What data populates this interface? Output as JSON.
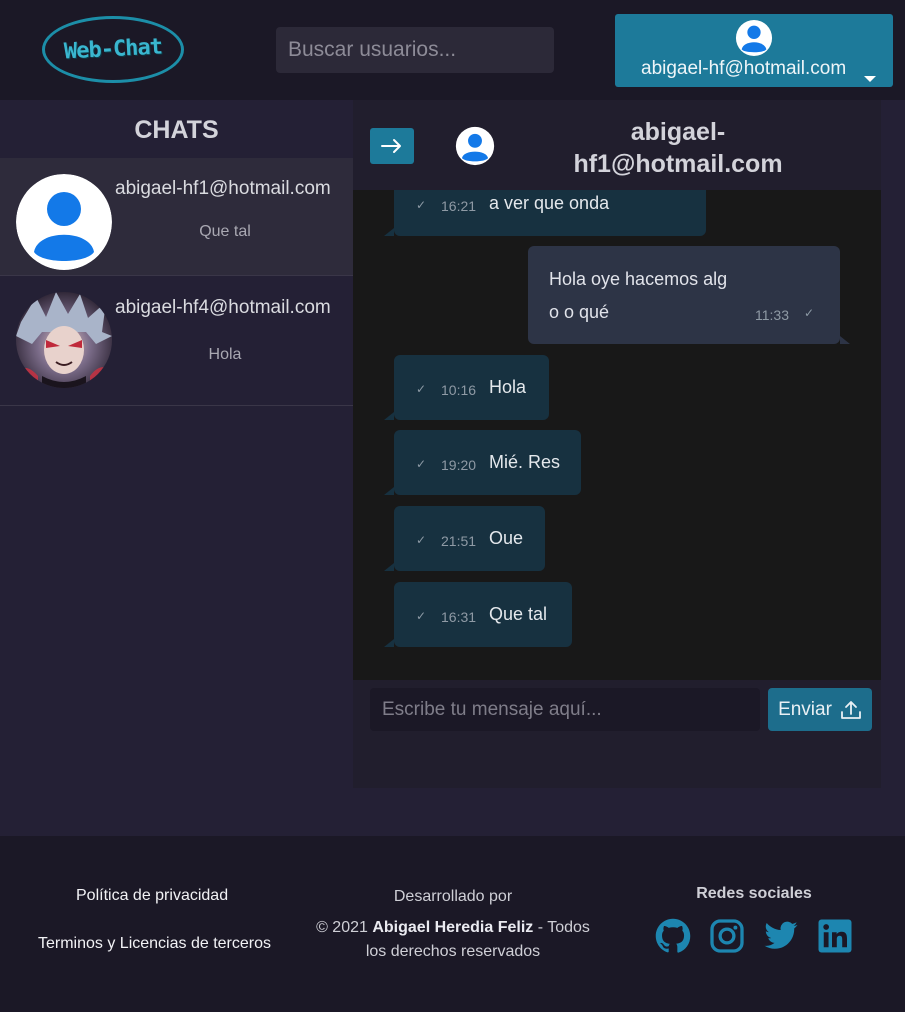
{
  "header": {
    "logo_text": "Web-Chat",
    "search_placeholder": "Buscar usuarios...",
    "account_email": "abigael-hf@hotmail.com"
  },
  "sidebar": {
    "title": "CHATS",
    "chats": [
      {
        "name": "abigael-hf1@hotmail.com",
        "last_message": "Que tal",
        "avatar": "default-user-icon",
        "active": true
      },
      {
        "name": "abigael-hf4@hotmail.com",
        "last_message": "Hola",
        "avatar": "anime-character-photo",
        "active": false
      }
    ]
  },
  "conversation": {
    "contact": "abigael-hf1@hotmail.com",
    "messages": [
      {
        "direction": "in",
        "time": "16:21",
        "text": "a ver que onda"
      },
      {
        "direction": "out",
        "time": "11:33",
        "text": "Hola oye hacemos algo o qué",
        "text_line1": "Hola oye hacemos alg",
        "text_line2": "o o qué"
      },
      {
        "direction": "in",
        "time": "10:16",
        "text": "Hola"
      },
      {
        "direction": "in",
        "time": "19:20",
        "text": "Mié. Res"
      },
      {
        "direction": "in",
        "time": "21:51",
        "text": "Oue"
      },
      {
        "direction": "in",
        "time": "16:31",
        "text": "Que tal"
      }
    ],
    "input_placeholder": "Escribe tu mensaje aquí...",
    "send_label": "Enviar"
  },
  "footer": {
    "privacy": "Política de privacidad",
    "terms": "Terminos y Licencias de terceros",
    "developed_by": "Desarrollado por",
    "copyright_prefix": "© 2021",
    "author": "Abigael Heredia Feliz",
    "copyright_suffix_line1": "- Todos",
    "copyright_suffix_line2": "los derechos reservados",
    "social_title": "Redes sociales",
    "social_icons": [
      "github-icon",
      "instagram-icon",
      "twitter-icon",
      "linkedin-icon"
    ]
  },
  "colors": {
    "accent": "#1d7a9a",
    "background": "#242035",
    "header_bg": "#1b1826",
    "incoming_bubble": "#173140",
    "outgoing_bubble": "#2d3446",
    "social_icon": "#1d86b0"
  }
}
